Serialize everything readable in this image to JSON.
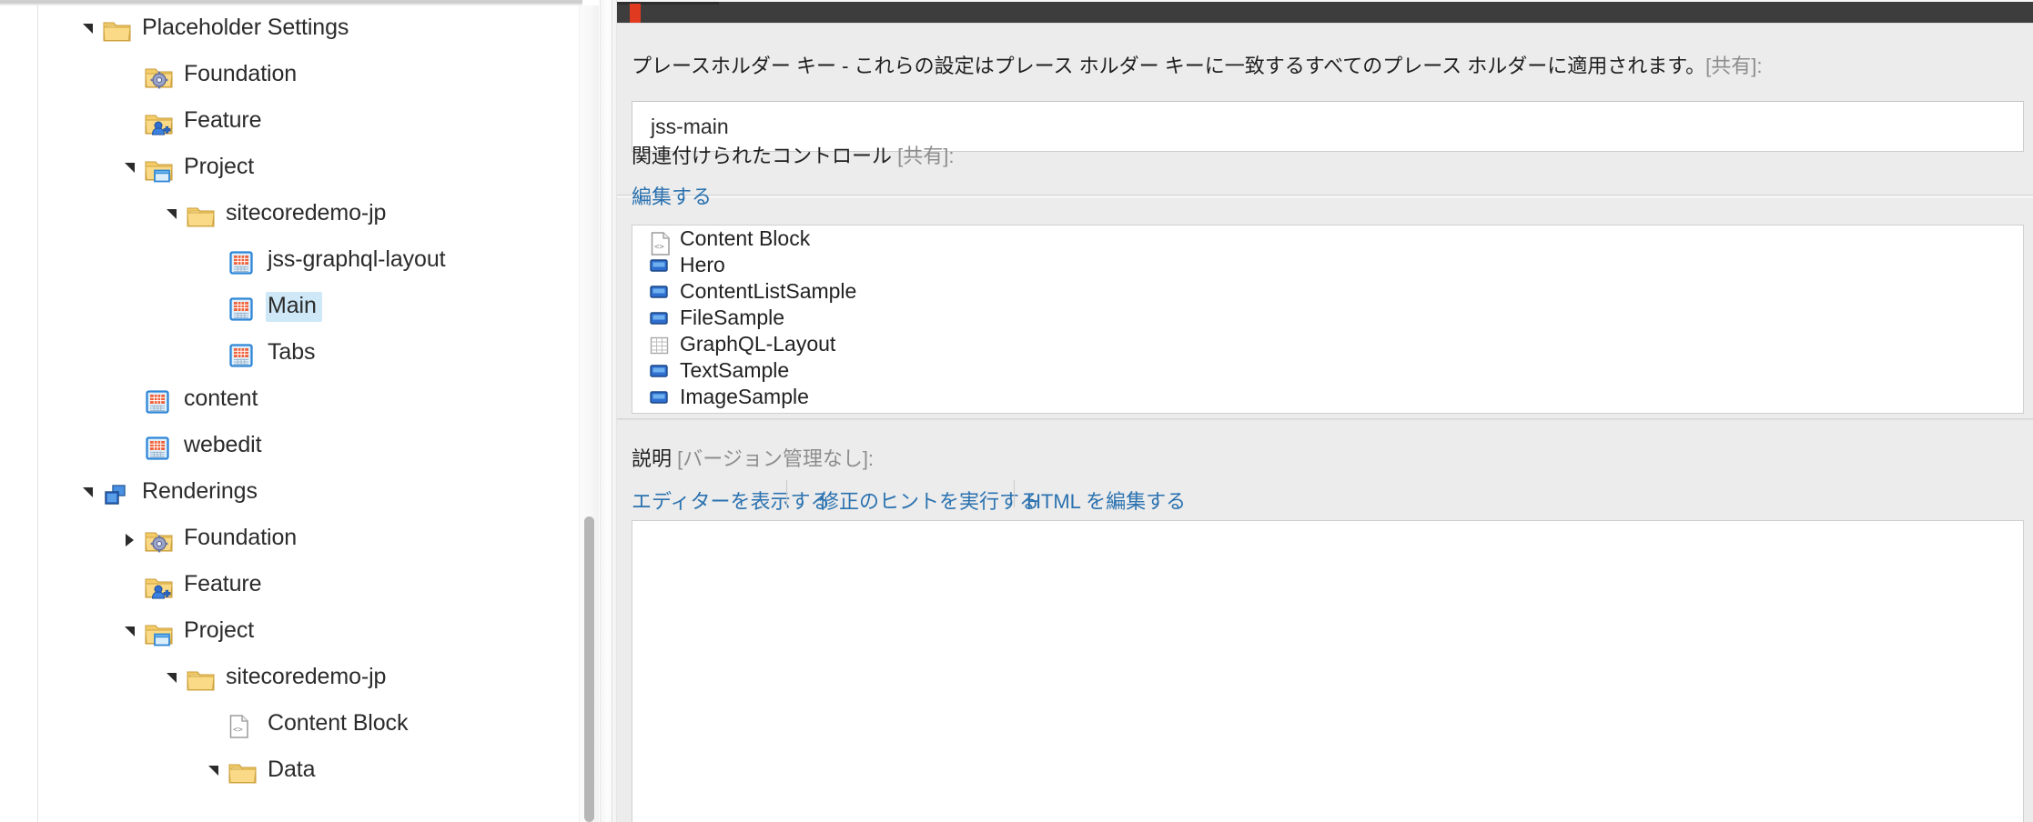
{
  "window": {
    "accent_color": "#e03a21",
    "ribbon_color": "#3d3d3d",
    "field_bg": "#ececec",
    "link_color": "#2b72b0",
    "selection_color": "#cfe8f7"
  },
  "content_tree": {
    "scroll_visible": true,
    "items": [
      {
        "label": "Placeholder Settings",
        "indent": 0,
        "twisty": "expanded",
        "icon": "folder-icon",
        "selected": false
      },
      {
        "label": "Foundation",
        "indent": 1,
        "twisty": "none",
        "icon": "folder-gear-icon",
        "selected": false
      },
      {
        "label": "Feature",
        "indent": 1,
        "twisty": "none",
        "icon": "folder-feature-icon",
        "selected": false
      },
      {
        "label": "Project",
        "indent": 1,
        "twisty": "expanded",
        "icon": "folder-project-icon",
        "selected": false
      },
      {
        "label": "sitecoredemo-jp",
        "indent": 2,
        "twisty": "expanded",
        "icon": "folder-icon",
        "selected": false
      },
      {
        "label": "jss-graphql-layout",
        "indent": 3,
        "twisty": "none",
        "icon": "placeholder-item-icon",
        "selected": false
      },
      {
        "label": "Main",
        "indent": 3,
        "twisty": "none",
        "icon": "placeholder-item-icon",
        "selected": true
      },
      {
        "label": "Tabs",
        "indent": 3,
        "twisty": "none",
        "icon": "placeholder-item-icon",
        "selected": false
      },
      {
        "label": "content",
        "indent": 1,
        "twisty": "none",
        "icon": "placeholder-item-icon",
        "selected": false
      },
      {
        "label": "webedit",
        "indent": 1,
        "twisty": "none",
        "icon": "placeholder-item-icon",
        "selected": false
      },
      {
        "label": "Renderings",
        "indent": 0,
        "twisty": "expanded",
        "icon": "renderings-icon",
        "selected": false
      },
      {
        "label": "Foundation",
        "indent": 1,
        "twisty": "collapsed",
        "icon": "folder-gear-icon",
        "selected": false
      },
      {
        "label": "Feature",
        "indent": 1,
        "twisty": "none",
        "icon": "folder-feature-icon",
        "selected": false
      },
      {
        "label": "Project",
        "indent": 1,
        "twisty": "expanded",
        "icon": "folder-project-icon",
        "selected": false
      },
      {
        "label": "sitecoredemo-jp",
        "indent": 2,
        "twisty": "expanded",
        "icon": "folder-icon",
        "selected": false
      },
      {
        "label": "Content Block",
        "indent": 3,
        "twisty": "none",
        "icon": "code-file-icon",
        "selected": false
      },
      {
        "label": "Data",
        "indent": 3,
        "twisty": "expanded",
        "icon": "folder-icon",
        "selected": false
      }
    ]
  },
  "editor": {
    "placeholder_key": {
      "label_main": "プレースホルダー キー - これらの設定はプレース ホルダー キーに一致するすべてのプレース ホルダーに適用されます。",
      "label_shared": "[共有]:",
      "value": "jss-main",
      "placeholder": ""
    },
    "associated_controls": {
      "label_main": "関連付けられたコントロール",
      "label_shared": "[共有]:",
      "edit_link": "編集する",
      "items": [
        {
          "label": "Content Block",
          "icon": "code-file-icon"
        },
        {
          "label": "Hero",
          "icon": "rendering-icon"
        },
        {
          "label": "ContentListSample",
          "icon": "rendering-icon"
        },
        {
          "label": "FileSample",
          "icon": "rendering-icon"
        },
        {
          "label": "GraphQL-Layout",
          "icon": "grid-layout-icon"
        },
        {
          "label": "TextSample",
          "icon": "rendering-icon"
        },
        {
          "label": "ImageSample",
          "icon": "rendering-icon"
        }
      ]
    },
    "description": {
      "label_main": "説明",
      "label_shared": "[バージョン管理なし]:",
      "links": [
        "エディターを表示する",
        "修正のヒントを実行する",
        "HTML を編集する"
      ],
      "value": ""
    }
  }
}
